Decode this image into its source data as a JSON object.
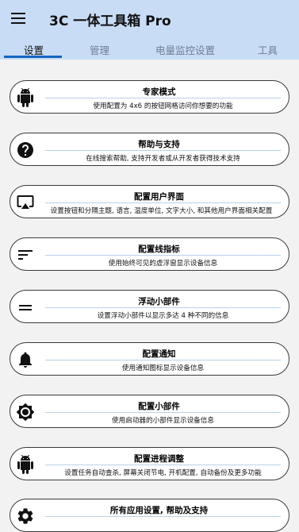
{
  "app": {
    "title": "3C 一体工具箱 Pro"
  },
  "tabs": [
    {
      "label": "设置",
      "active": true
    },
    {
      "label": "管理"
    },
    {
      "label": "电量监控设置"
    },
    {
      "label": "工具"
    }
  ],
  "cards": [
    {
      "icon": "android-icon",
      "title": "专家模式",
      "desc": "使用配置为 4x6 的按钮网格访问你想要的功能"
    },
    {
      "icon": "help-icon",
      "title": "帮助与支持",
      "desc": "在线搜索帮助, 支持开发者或从开发者获得技术支持"
    },
    {
      "icon": "cast-screen-icon",
      "title": "配置用户界面",
      "desc": "设置按钮和分隔主题, 语言, 温度单位, 文字大小, 和其他用户界面相关配置"
    },
    {
      "icon": "sort-lines-icon",
      "title": "配置线指标",
      "desc": "使用始终可见的虚浮窗显示设备信息"
    },
    {
      "icon": "equals-icon",
      "title": "浮动小部件",
      "desc": "设置浮动小部件以显示多达 4 种不同的信息"
    },
    {
      "icon": "bell-icon",
      "title": "配置通知",
      "desc": "使用通知图标显示设备信息"
    },
    {
      "icon": "brightness-icon",
      "title": "配置小部件",
      "desc": "使用启动器的小部件显示设备信息"
    },
    {
      "icon": "android-icon",
      "title": "配置进程调整",
      "desc": "设置任务自动查杀, 屏幕关闭节电, 开机配置, 自动备份及更多功能"
    },
    {
      "icon": "gear-icon",
      "title": "所有应用设置, 帮助及支持",
      "desc": ""
    }
  ]
}
